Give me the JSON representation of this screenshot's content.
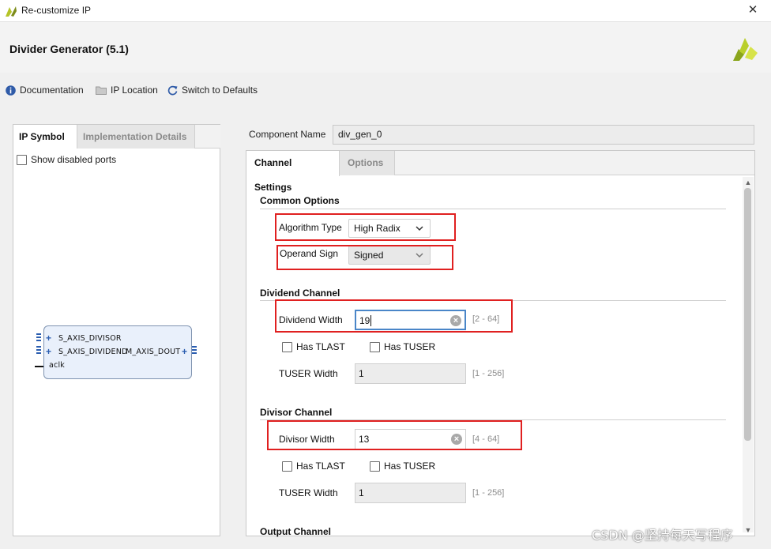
{
  "window": {
    "title": "Re-customize IP",
    "close_glyph": "✕"
  },
  "header": {
    "ip_title": "Divider Generator (5.1)",
    "logo_icon": "xilinx-logo-icon"
  },
  "toolbar": {
    "documentation": "Documentation",
    "ip_location": "IP Location",
    "switch_defaults": "Switch to Defaults"
  },
  "left_panel": {
    "tabs": [
      "IP Symbol",
      "Implementation Details"
    ],
    "show_disabled_ports": "Show disabled ports",
    "symbol": {
      "ports_left": [
        "S_AXIS_DIVISOR",
        "S_AXIS_DIVIDEND",
        "aclk"
      ],
      "ports_right": [
        "M_AXIS_DOUT"
      ]
    }
  },
  "component": {
    "label": "Component Name",
    "value": "div_gen_0"
  },
  "right_panel": {
    "tabs": [
      "Channel Settings",
      "Options"
    ],
    "common_options": {
      "title": "Common Options",
      "algorithm_type_label": "Algorithm Type",
      "algorithm_type_value": "High Radix",
      "operand_sign_label": "Operand Sign",
      "operand_sign_value": "Signed"
    },
    "dividend_channel": {
      "title": "Dividend Channel",
      "width_label": "Dividend Width",
      "width_value": "19",
      "width_range": "[2 - 64]",
      "has_tlast": "Has TLAST",
      "has_tuser": "Has TUSER",
      "tuser_width_label": "TUSER Width",
      "tuser_width_value": "1",
      "tuser_width_range": "[1 - 256]"
    },
    "divisor_channel": {
      "title": "Divisor Channel",
      "width_label": "Divisor Width",
      "width_value": "13",
      "width_range": "[4 - 64]",
      "has_tlast": "Has TLAST",
      "has_tuser": "Has TUSER",
      "tuser_width_label": "TUSER Width",
      "tuser_width_value": "1",
      "tuser_width_range": "[1 - 256]"
    },
    "output_channel": {
      "title": "Output Channel"
    }
  },
  "watermark": "CSDN @坚持每天写程序",
  "colors": {
    "highlight_red": "#e02020",
    "focus_blue": "#4a86c8",
    "symbol_fill": "#e9f0fb",
    "symbol_blue": "#2a5db0"
  }
}
